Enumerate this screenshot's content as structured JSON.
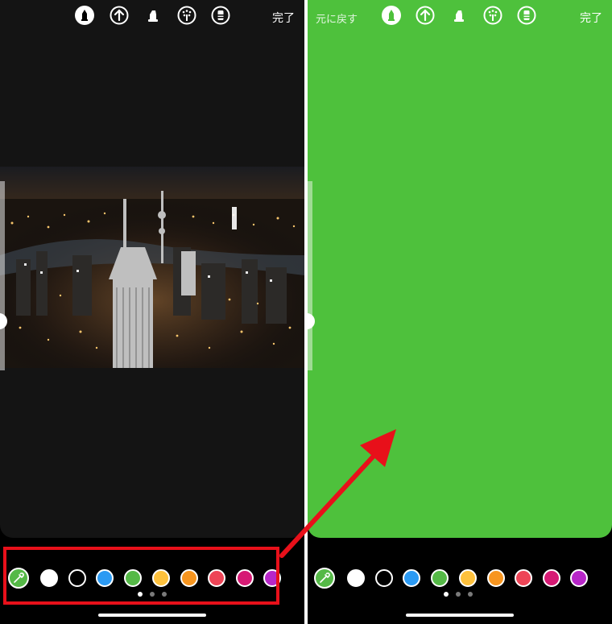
{
  "left_panel": {
    "done_label": "完了",
    "tools": [
      "pen-icon",
      "arrow-up-icon",
      "marker-icon",
      "sparkle-pen-icon",
      "eraser-icon"
    ]
  },
  "right_panel": {
    "undo_label": "元に戻す",
    "done_label": "完了",
    "tools": [
      "pen-icon",
      "arrow-up-icon",
      "marker-icon",
      "sparkle-pen-icon",
      "eraser-icon"
    ],
    "background_color": "#4ec13c"
  },
  "palette": {
    "colors": [
      {
        "name": "eyedropper",
        "hex": "#55b947"
      },
      {
        "name": "white",
        "hex": "#ffffff"
      },
      {
        "name": "black",
        "hex": "#000000"
      },
      {
        "name": "blue",
        "hex": "#2b9af3"
      },
      {
        "name": "green",
        "hex": "#55b947"
      },
      {
        "name": "yellow",
        "hex": "#fdc13d"
      },
      {
        "name": "orange",
        "hex": "#f7951f"
      },
      {
        "name": "red",
        "hex": "#ee4557"
      },
      {
        "name": "pink",
        "hex": "#d61a74"
      },
      {
        "name": "purple",
        "hex": "#b726c8"
      }
    ],
    "page_dots": 3,
    "active_page": 1
  },
  "annotation": {
    "highlight_color": "#e8101a",
    "arrow_color": "#e8101a"
  }
}
